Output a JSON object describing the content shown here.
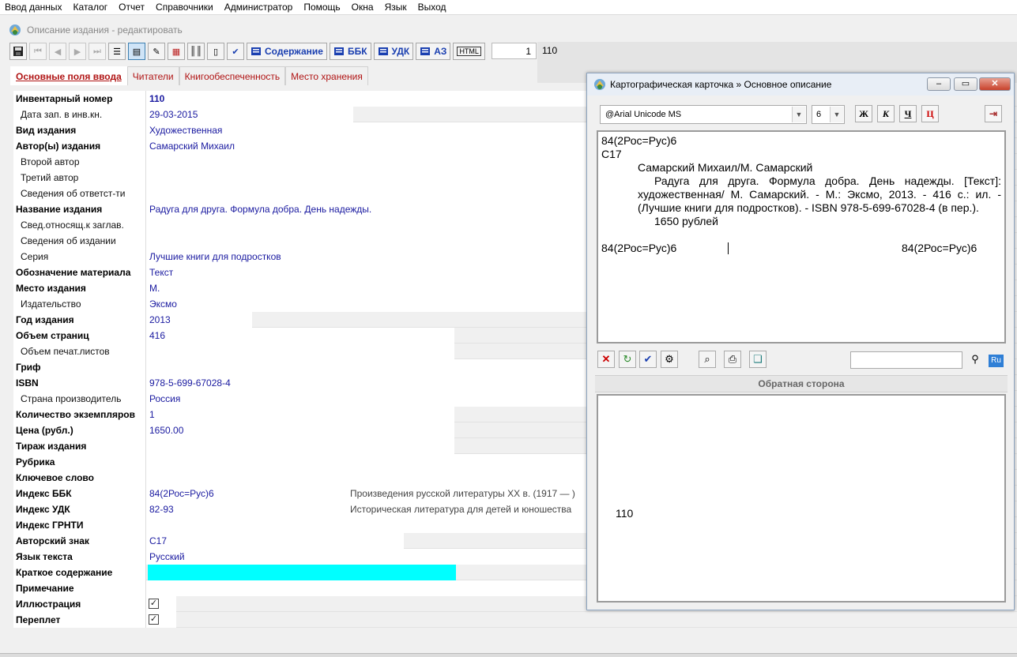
{
  "menu": [
    "Ввод данных",
    "Каталог",
    "Отчет",
    "Справочники",
    "Администратор",
    "Помощь",
    "Окна",
    "Язык",
    "Выход"
  ],
  "child": {
    "title": "Описание издания - редактировать",
    "toolbar": {
      "content": "Содержание",
      "bbk": "ББК",
      "udk": "УДК",
      "az": "АЗ",
      "html": "HTML"
    },
    "counter_value": "1",
    "counter_label": "110"
  },
  "tabs": [
    "Основные поля ввода",
    "Читатели",
    "Книгообеспеченность",
    "Место хранения"
  ],
  "fields": [
    {
      "label": "Инвентарный номер",
      "value": "110"
    },
    {
      "label": "Дата зап. в инв.кн.",
      "value": "29-03-2015"
    },
    {
      "label": "Вид издания",
      "value": "Художественная"
    },
    {
      "label": "Автор(ы) издания",
      "value": "Самарский Михаил"
    },
    {
      "label": "Второй автор",
      "value": ""
    },
    {
      "label": "Третий автор",
      "value": ""
    },
    {
      "label": "Сведения об ответст-ти",
      "value": ""
    },
    {
      "label": "Название издания",
      "value": "Радуга для друга. Формула добра. День надежды."
    },
    {
      "label": "Свед.относящ.к заглав.",
      "value": ""
    },
    {
      "label": "Сведения об издании",
      "value": ""
    },
    {
      "label": "Серия",
      "value": "Лучшие книги для подростков"
    },
    {
      "label": "Обозначение материала",
      "value": "Текст"
    },
    {
      "label": "Место издания",
      "value": "М."
    },
    {
      "label": "Издательство",
      "value": "Эксмо"
    },
    {
      "label": "Год издания",
      "value": "2013"
    },
    {
      "label": "Объем страниц",
      "value": "416"
    },
    {
      "label": "Объем печат.листов",
      "value": ""
    },
    {
      "label": "Гриф",
      "value": ""
    },
    {
      "label": "ISBN",
      "value": "978-5-699-67028-4"
    },
    {
      "label": "Страна производитель",
      "value": "Россия"
    },
    {
      "label": "Количество экземпляров",
      "value": "1"
    },
    {
      "label": "Цена (рубл.)",
      "value": "1650.00"
    },
    {
      "label": "Тираж издания",
      "value": ""
    },
    {
      "label": "Рубрика",
      "value": ""
    },
    {
      "label": "Ключевое слово",
      "value": ""
    },
    {
      "label": "Индекс ББК",
      "value": "84(2Рос=Рус)6",
      "extra": "Произведения русской литературы XX в. (1917 — )"
    },
    {
      "label": "Индекс УДК",
      "value": "82-93",
      "extra": "Историческая литература для детей и юношества"
    },
    {
      "label": "Индекс ГРНТИ",
      "value": ""
    },
    {
      "label": "Авторский знак",
      "value": "С17"
    },
    {
      "label": "Язык текста",
      "value": "Русский"
    },
    {
      "label": "Краткое содержание",
      "value": ""
    },
    {
      "label": "Примечание",
      "value": ""
    },
    {
      "label": "Иллюстрация",
      "value": "",
      "checked": true
    },
    {
      "label": "Переплет",
      "value": "",
      "checked": true
    }
  ],
  "card": {
    "title": "Картографическая карточка » Основное описание",
    "font": "@Arial Unicode MS",
    "size": "6",
    "fmt": [
      "Ж",
      "К",
      "Ч",
      "Ц"
    ],
    "lines": {
      "l1": "84(2Рос=Рус)6",
      "l2": "С17",
      "author": "Самарский Михаил/М. Самарский",
      "desc": "Радуга для друга. Формула добра. День надежды. [Текст]: художественная/ М. Самарский. - М.: Эксмо, 2013. - 416 с.: ил. - (Лучшие книги для подростков). - ISBN 978-5-699-67028-4 (в пер.).",
      "price": "1650 рублей",
      "bottom_left": "84(2Рос=Рус)6",
      "bottom_right": "84(2Рос=Рус)6"
    },
    "ru": "Ru",
    "back_header": "Обратная сторона",
    "back_number": "110"
  }
}
